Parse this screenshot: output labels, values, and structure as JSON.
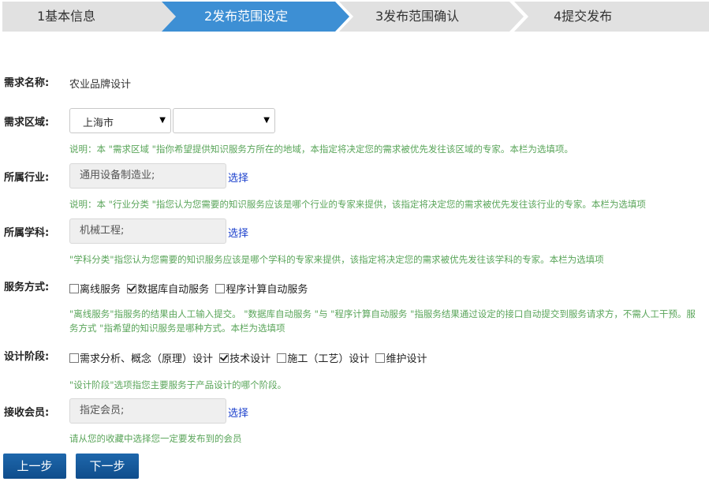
{
  "steps": [
    {
      "label": "1基本信息",
      "active": false
    },
    {
      "label": "2发布范围设定",
      "active": true
    },
    {
      "label": "3发布范围确认",
      "active": false
    },
    {
      "label": "4提交发布",
      "active": false
    }
  ],
  "colors": {
    "active_step": "#3d8fd4",
    "inactive_step": "#e1e1e1",
    "hint": "#5aa55a",
    "link": "#1a3fcc",
    "button": "#1659a0"
  },
  "demand_name": {
    "label": "需求名称:",
    "value": "农业品牌设计"
  },
  "region": {
    "label": "需求区域:",
    "province": "上海市",
    "city": "",
    "hint": "说明：本 \"需求区域 \"指你希望提供知识服务方所在的地域，本指定将决定您的需求被优先发往该区域的专家。本栏为选填项。"
  },
  "industry": {
    "label": "所属行业:",
    "value": "通用设备制造业;",
    "pick": "选择",
    "hint": "说明：本 \"行业分类 \"指您认为您需要的知识服务应该是哪个行业的专家来提供，该指定将决定您的需求被优先发往该行业的专家。本栏为选填项"
  },
  "discipline": {
    "label": "所属学科:",
    "value": "机械工程;",
    "pick": "选择",
    "hint": "\"学科分类\"指您认为您需要的知识服务应该是哪个学科的专家来提供，该指定将决定您的需求被优先发往该学科的专家。本栏为选填项"
  },
  "service_mode": {
    "label": "服务方式:",
    "options": [
      {
        "label": "离线服务",
        "checked": false
      },
      {
        "label": "数据库自动服务",
        "checked": true
      },
      {
        "label": "程序计算自动服务",
        "checked": false
      }
    ],
    "hint": "\"离线服务\"指服务的结果由人工输入提交。 \"数据库自动服务 \"与 \"程序计算自动服务 \"指服务结果通过设定的接口自动提交到服务请求方，不需人工干预。服务方式 \"指希望的知识服务是哪种方式。本栏为选填项"
  },
  "design_stage": {
    "label": "设计阶段:",
    "options": [
      {
        "label": "需求分析、概念（原理）设计",
        "checked": false
      },
      {
        "label": "技术设计",
        "checked": true
      },
      {
        "label": "施工（工艺）设计",
        "checked": false
      },
      {
        "label": "维护设计",
        "checked": false
      }
    ],
    "hint": "\"设计阶段\"选项指您主要服务于产品设计的哪个阶段。"
  },
  "receiver": {
    "label": "接收会员:",
    "value": "指定会员;",
    "pick": "选择",
    "hint": "请从您的收藏中选择您一定要发布到的会员"
  },
  "buttons": {
    "prev": "上一步",
    "next": "下一步"
  }
}
